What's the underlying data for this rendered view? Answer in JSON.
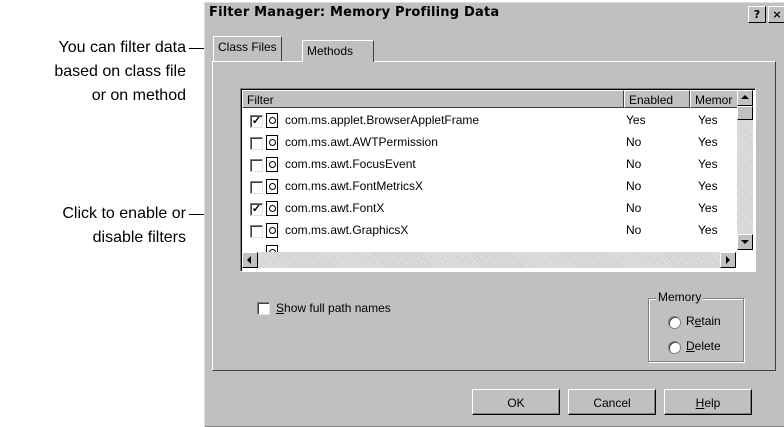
{
  "callouts": {
    "filter_note": [
      "You can filter data",
      "based on class file",
      "or on method"
    ],
    "enable_note": [
      "Click to enable or",
      "disable filters"
    ]
  },
  "window": {
    "title": "Filter Manager: Memory Profiling Data",
    "help_glyph": "?",
    "close_glyph": "×"
  },
  "tabs": [
    "Class Files",
    "Methods"
  ],
  "list": {
    "columns": [
      "Filter",
      "Enabled",
      "Memor"
    ],
    "rows": [
      {
        "name": "com.ms.applet.BrowserAppletFrame",
        "enabled": "Yes",
        "memory": "Yes",
        "checked": true
      },
      {
        "name": "com.ms.awt.AWTPermission",
        "enabled": "No",
        "memory": "Yes",
        "checked": false
      },
      {
        "name": "com.ms.awt.FocusEvent",
        "enabled": "No",
        "memory": "Yes",
        "checked": false
      },
      {
        "name": "com.ms.awt.FontMetricsX",
        "enabled": "No",
        "memory": "Yes",
        "checked": false
      },
      {
        "name": "com.ms.awt.FontX",
        "enabled": "No",
        "memory": "Yes",
        "checked": true
      },
      {
        "name": "com.ms.awt.GraphicsX",
        "enabled": "No",
        "memory": "Yes",
        "checked": false
      }
    ]
  },
  "options": {
    "show_full_path": "Show full path names",
    "memory_group": "Memory",
    "retain": "Retain",
    "delete": "Delete"
  },
  "buttons": {
    "ok": "OK",
    "cancel": "Cancel",
    "help": "Help"
  }
}
